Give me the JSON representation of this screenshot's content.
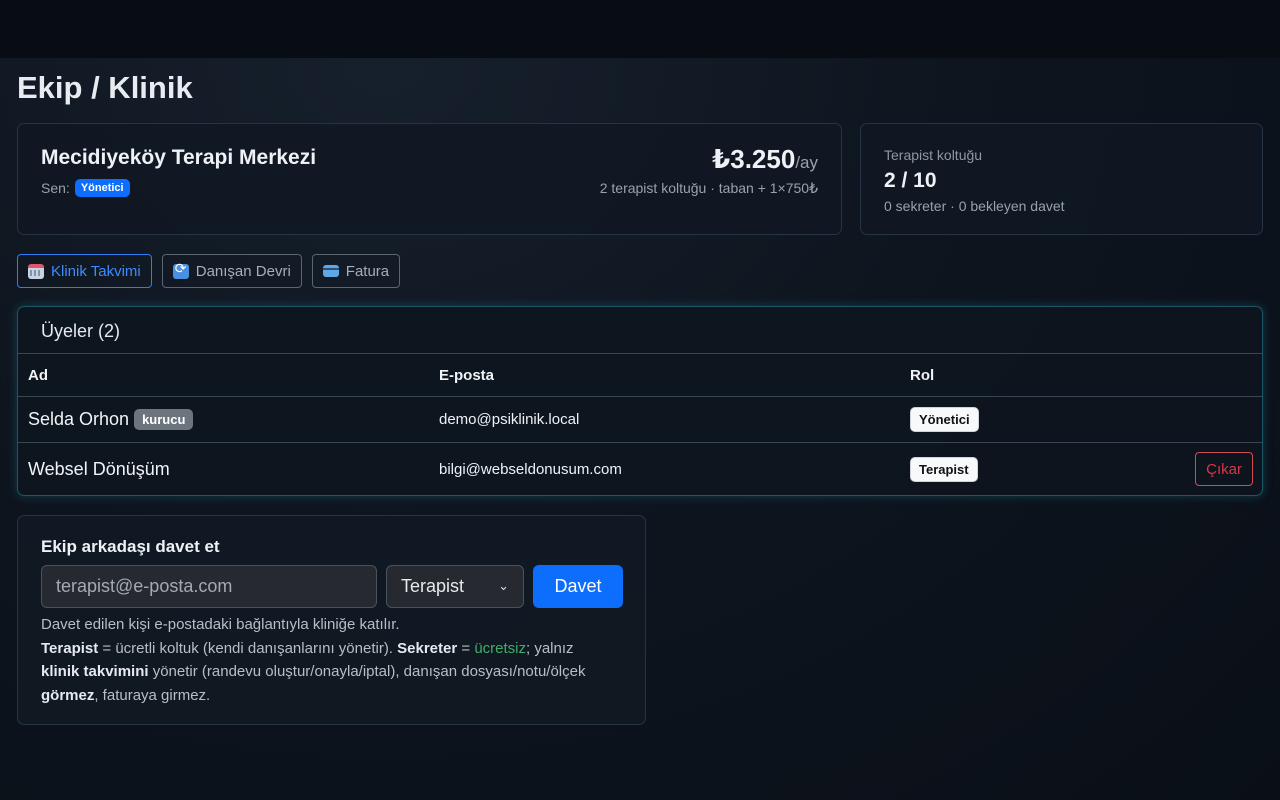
{
  "page": {
    "title": "Ekip / Klinik"
  },
  "clinic": {
    "name": "Mecidiyeköy Terapi Merkezi",
    "role_prefix": "Sen:",
    "role_badge": "Yönetici",
    "price": "₺3.250",
    "price_period": "/ay",
    "price_detail": "2 terapist koltuğu · taban + 1×750₺"
  },
  "seats": {
    "label": "Terapist koltuğu",
    "value": "2 / 10",
    "detail": "0 sekreter · 0 bekleyen davet"
  },
  "actions": [
    {
      "label": "Klinik Takvimi",
      "icon": "calendar-icon",
      "active": true
    },
    {
      "label": "Danışan Devri",
      "icon": "sync-icon",
      "active": false
    },
    {
      "label": "Fatura",
      "icon": "credit-card-icon",
      "active": false
    }
  ],
  "members": {
    "title": "Üyeler (2)",
    "columns": [
      "Ad",
      "E-posta",
      "Rol"
    ],
    "rows": [
      {
        "name": "Selda Orhon",
        "tag": "kurucu",
        "email": "demo@psiklinik.local",
        "role": "Yönetici"
      },
      {
        "name": "Websel Dönüşüm",
        "email": "bilgi@webseldonusum.com",
        "role": "Terapist",
        "remove_label": "Çıkar"
      }
    ]
  },
  "invite": {
    "title": "Ekip arkadaşı davet et",
    "email_placeholder": "terapist@e-posta.com",
    "role_selected": "Terapist",
    "submit_label": "Davet",
    "help": {
      "line1": "Davet edilen kişi e-postadaki bağlantıyla kliniğe katılır.",
      "therapist_term": "Terapist",
      "therapist_desc": " = ücretli koltuk (kendi danışanlarını yönetir). ",
      "secretary_term": "Sekreter",
      "eq": " = ",
      "free": "ücretsiz",
      "after_free": "; yalnız ",
      "calendar_term": "klinik takvimini",
      "calendar_desc": " yönetir (randevu oluştur/onayla/iptal), danışan dosyası/notu/ölçek ",
      "see_term": "görmez",
      "end": ", faturaya girmez."
    }
  },
  "colors": {
    "accent": "#0d6efd",
    "danger": "#dc3545",
    "free": "#3fae6a"
  }
}
